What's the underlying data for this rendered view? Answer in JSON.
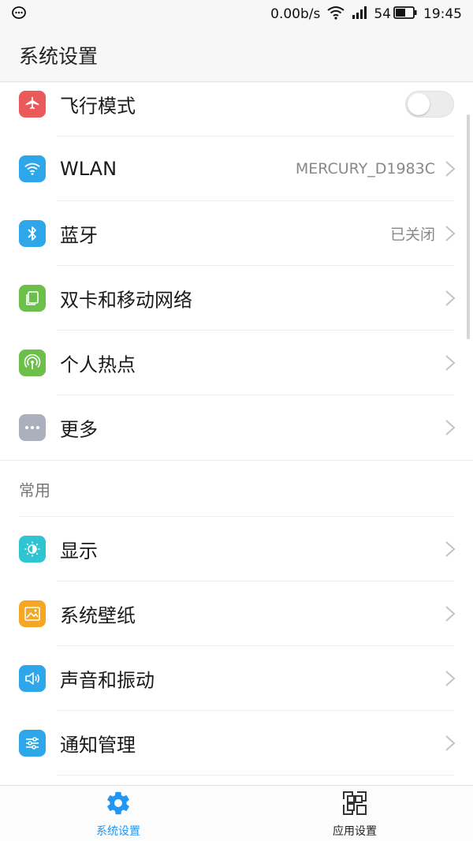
{
  "status_bar": {
    "speed": "0.00b/s",
    "battery": "54",
    "time": "19:45"
  },
  "header": {
    "title": "系统设置"
  },
  "colors": {
    "airplane": "#ea5a5a",
    "wlan": "#2ea7ea",
    "bluetooth": "#2ea7ea",
    "sim": "#6cbf4a",
    "hotspot": "#6cbf4a",
    "more": "#aab1bc",
    "display": "#2ec4d2",
    "wallpaper": "#f5a623",
    "sound": "#2ea7ea",
    "notification": "#2ea7ea",
    "accent": "#2196f3"
  },
  "network_items": [
    {
      "label": "飞行模式",
      "icon": "airplane-icon",
      "toggle": false
    },
    {
      "label": "WLAN",
      "icon": "wifi-icon",
      "value": "MERCURY_D1983C"
    },
    {
      "label": "蓝牙",
      "icon": "bluetooth-icon",
      "value": "已关闭"
    },
    {
      "label": "双卡和移动网络",
      "icon": "sim-card-icon"
    },
    {
      "label": "个人热点",
      "icon": "hotspot-icon"
    },
    {
      "label": "更多",
      "icon": "more-icon"
    }
  ],
  "section_common": {
    "title": "常用"
  },
  "common_items": [
    {
      "label": "显示",
      "icon": "display-icon"
    },
    {
      "label": "系统壁纸",
      "icon": "wallpaper-icon"
    },
    {
      "label": "声音和振动",
      "icon": "sound-icon"
    },
    {
      "label": "通知管理",
      "icon": "notification-icon"
    }
  ],
  "bottom_nav": {
    "system_settings": "系统设置",
    "app_settings": "应用设置"
  }
}
